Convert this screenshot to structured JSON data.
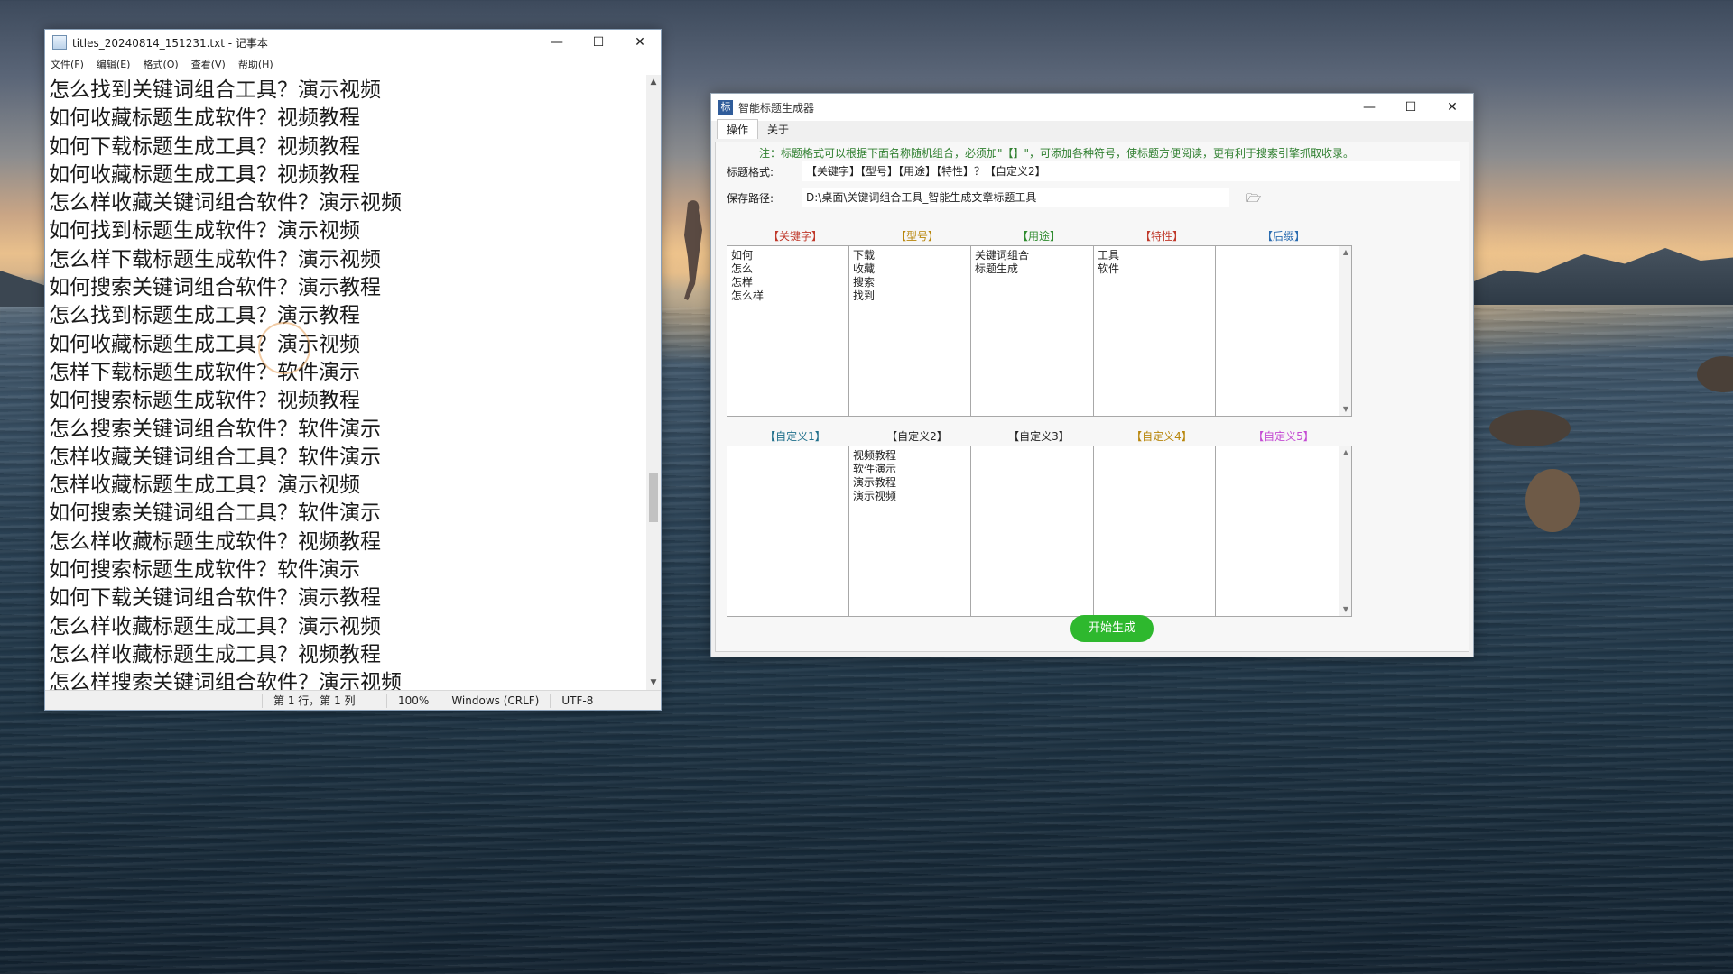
{
  "notepad": {
    "title": "titles_20240814_151231.txt - 记事本",
    "menu": [
      "文件(F)",
      "编辑(E)",
      "格式(O)",
      "查看(V)",
      "帮助(H)"
    ],
    "lines": [
      "怎么找到关键词组合工具？演示视频",
      "如何收藏标题生成软件？视频教程",
      "如何下载标题生成工具？视频教程",
      "如何收藏标题生成工具？视频教程",
      "怎么样收藏关键词组合软件？演示视频",
      "如何找到标题生成软件？演示视频",
      "怎么样下载标题生成软件？演示视频",
      "如何搜索关键词组合软件？演示教程",
      "怎么找到标题生成工具？演示教程",
      "如何收藏标题生成工具？演示视频",
      "怎样下载标题生成软件？软件演示",
      "如何搜索标题生成软件？视频教程",
      "怎么搜索关键词组合软件？软件演示",
      "怎样收藏关键词组合工具？软件演示",
      "怎样收藏标题生成工具？演示视频",
      "如何搜索关键词组合工具？软件演示",
      "怎么样收藏标题生成软件？视频教程",
      "如何搜索标题生成软件？软件演示",
      "如何下载关键词组合软件？演示教程",
      "怎么样收藏标题生成工具？演示视频",
      "怎么样收藏标题生成工具？视频教程",
      "怎么样搜索关键词组合软件？演示视频"
    ],
    "status": {
      "position": "第 1 行，第 1 列",
      "zoom": "100%",
      "line_ending": "Windows (CRLF)",
      "encoding": "UTF-8"
    }
  },
  "generator": {
    "title": "智能标题生成器",
    "icon_char": "标",
    "tabs": [
      "操作",
      "关于"
    ],
    "note": "注：标题格式可以根据下面名称随机组合，必须加\"【】\"，可添加各种符号，使标题方便阅读，更有利于搜索引擎抓取收录。",
    "format_label": "标题格式:",
    "format_value": "【关键字】【型号】【用途】【特性】？【自定义2】",
    "path_label": "保存路径:",
    "path_value": "D:\\桌面\\关键词组合工具_智能生成文章标题工具",
    "columns_top": [
      {
        "label": "【关键字】",
        "color": "#c0392b",
        "items": [
          "如何",
          "怎么",
          "怎样",
          "怎么样"
        ]
      },
      {
        "label": "【型号】",
        "color": "#b8860b",
        "items": [
          "下载",
          "收藏",
          "搜索",
          "找到"
        ]
      },
      {
        "label": "【用途】",
        "color": "#2e8b2e",
        "items": [
          "关键词组合",
          "标题生成"
        ]
      },
      {
        "label": "【特性】",
        "color": "#c0392b",
        "items": [
          "工具",
          "软件"
        ]
      },
      {
        "label": "【后缀】",
        "color": "#2b6cb0",
        "items": []
      }
    ],
    "columns_bottom": [
      {
        "label": "【自定义1】",
        "color": "#1f6f8b",
        "items": []
      },
      {
        "label": "【自定义2】",
        "color": "#222222",
        "items": [
          "视频教程",
          "软件演示",
          "演示教程",
          "演示视频"
        ]
      },
      {
        "label": "【自定义3】",
        "color": "#222222",
        "items": []
      },
      {
        "label": "【自定义4】",
        "color": "#b8860b",
        "items": []
      },
      {
        "label": "【自定义5】",
        "color": "#c44bd3",
        "items": []
      }
    ],
    "start_button": "开始生成"
  }
}
